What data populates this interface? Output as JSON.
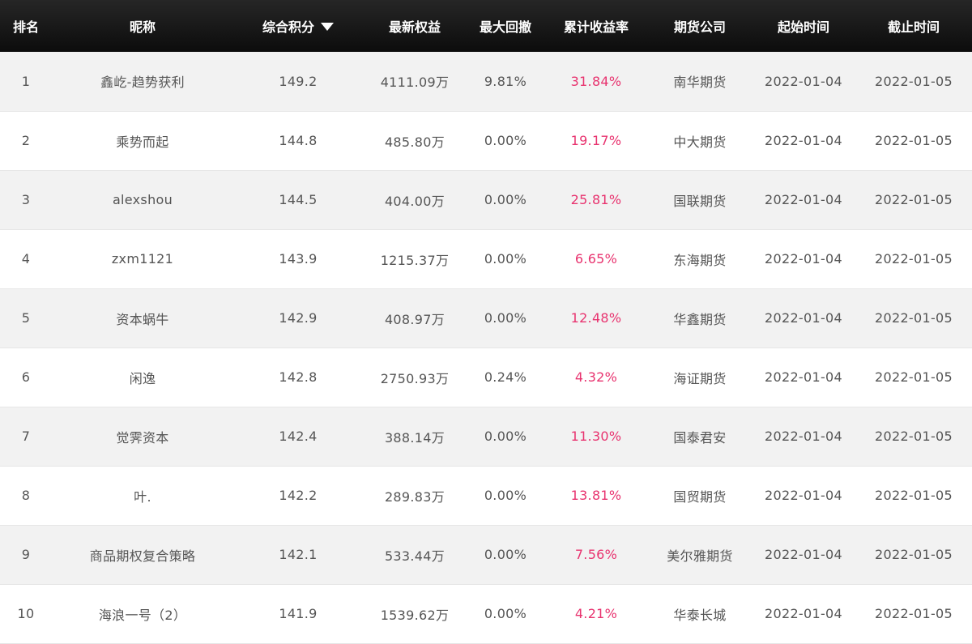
{
  "table": {
    "headers": [
      {
        "key": "rank",
        "label": "排名"
      },
      {
        "key": "nickname",
        "label": "昵称"
      },
      {
        "key": "score",
        "label": "综合积分",
        "sorted": "desc",
        "sort_icon": "triangle-down-icon"
      },
      {
        "key": "equity",
        "label": "最新权益"
      },
      {
        "key": "drawdown",
        "label": "最大回撤"
      },
      {
        "key": "return",
        "label": "累计收益率"
      },
      {
        "key": "company",
        "label": "期货公司"
      },
      {
        "key": "start",
        "label": "起始时间"
      },
      {
        "key": "end",
        "label": "截止时间"
      }
    ],
    "rows": [
      {
        "rank": "1",
        "nickname": "鑫屹-趋势获利",
        "score": "149.2",
        "equity": "4111.09万",
        "drawdown": "9.81%",
        "return": "31.84%",
        "company": "南华期货",
        "start": "2022-01-04",
        "end": "2022-01-05"
      },
      {
        "rank": "2",
        "nickname": "乘势而起",
        "score": "144.8",
        "equity": "485.80万",
        "drawdown": "0.00%",
        "return": "19.17%",
        "company": "中大期货",
        "start": "2022-01-04",
        "end": "2022-01-05"
      },
      {
        "rank": "3",
        "nickname": "alexshou",
        "score": "144.5",
        "equity": "404.00万",
        "drawdown": "0.00%",
        "return": "25.81%",
        "company": "国联期货",
        "start": "2022-01-04",
        "end": "2022-01-05"
      },
      {
        "rank": "4",
        "nickname": "zxm1121",
        "score": "143.9",
        "equity": "1215.37万",
        "drawdown": "0.00%",
        "return": "6.65%",
        "company": "东海期货",
        "start": "2022-01-04",
        "end": "2022-01-05"
      },
      {
        "rank": "5",
        "nickname": "资本蜗牛",
        "score": "142.9",
        "equity": "408.97万",
        "drawdown": "0.00%",
        "return": "12.48%",
        "company": "华鑫期货",
        "start": "2022-01-04",
        "end": "2022-01-05"
      },
      {
        "rank": "6",
        "nickname": "闲逸",
        "score": "142.8",
        "equity": "2750.93万",
        "drawdown": "0.24%",
        "return": "4.32%",
        "company": "海证期货",
        "start": "2022-01-04",
        "end": "2022-01-05"
      },
      {
        "rank": "7",
        "nickname": "觉霁资本",
        "score": "142.4",
        "equity": "388.14万",
        "drawdown": "0.00%",
        "return": "11.30%",
        "company": "国泰君安",
        "start": "2022-01-04",
        "end": "2022-01-05"
      },
      {
        "rank": "8",
        "nickname": "叶.",
        "score": "142.2",
        "equity": "289.83万",
        "drawdown": "0.00%",
        "return": "13.81%",
        "company": "国贸期货",
        "start": "2022-01-04",
        "end": "2022-01-05"
      },
      {
        "rank": "9",
        "nickname": "商品期权复合策略",
        "score": "142.1",
        "equity": "533.44万",
        "drawdown": "0.00%",
        "return": "7.56%",
        "company": "美尔雅期货",
        "start": "2022-01-04",
        "end": "2022-01-05"
      },
      {
        "rank": "10",
        "nickname": "海浪一号（2）",
        "score": "141.9",
        "equity": "1539.62万",
        "drawdown": "0.00%",
        "return": "4.21%",
        "company": "华泰长城",
        "start": "2022-01-04",
        "end": "2022-01-05"
      }
    ]
  },
  "colors": {
    "header_background": "#1a1a1a",
    "header_text": "#ffffff",
    "row_stripe": "#f2f2f2",
    "row_plain": "#ffffff",
    "body_text": "#555555",
    "return_text": "#e8336f"
  }
}
